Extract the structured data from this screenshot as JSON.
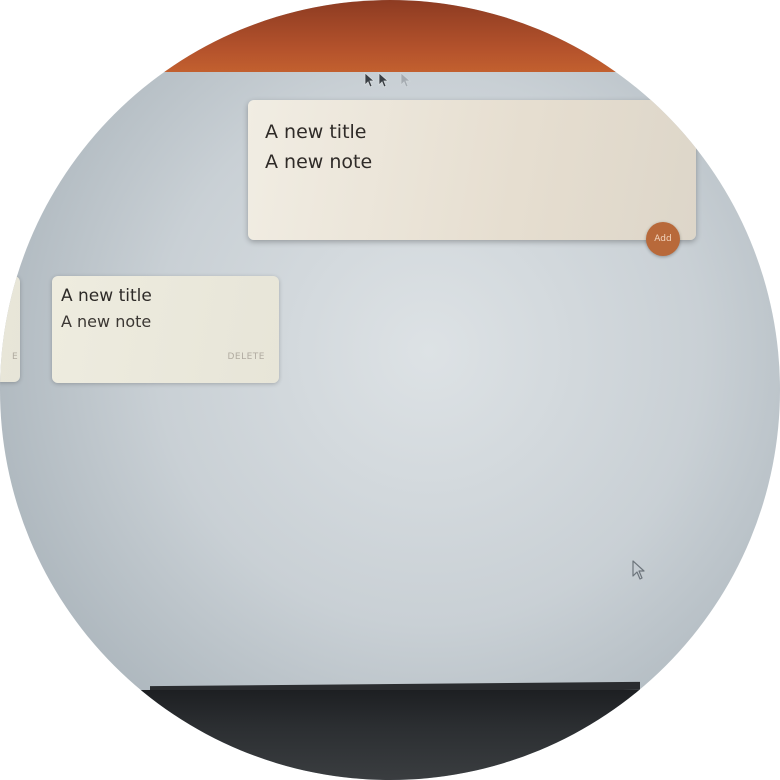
{
  "create_note": {
    "title_value": "A new title",
    "content_value": "A new note",
    "add_label": "Add"
  },
  "notes": [
    {
      "title": "A new title",
      "content": "A new note",
      "delete_label": "DELETE"
    }
  ],
  "partial_note": {
    "delete_label": "E"
  },
  "colors": {
    "header": "#b5532c",
    "card": "#eeecdf",
    "add_button": "#b8693a",
    "background": "#cfd5d9"
  },
  "icons": {
    "header_cursors": "arrow-cursor-icon",
    "mouse_pointer": "mouse-pointer-icon"
  }
}
